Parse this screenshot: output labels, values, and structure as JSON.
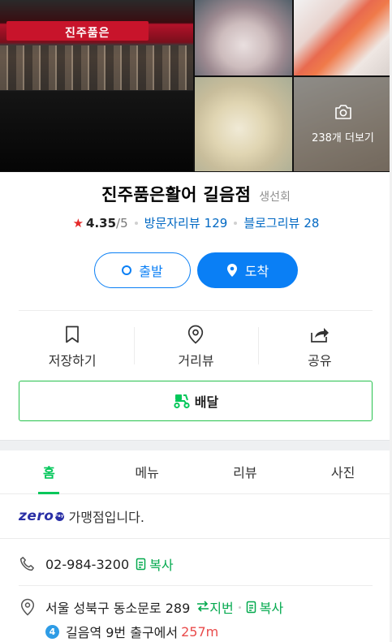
{
  "gallery": {
    "main_sign_text": "진주품은",
    "photo_count_label": "238개 더보기"
  },
  "place": {
    "name": "진주품은활어 길음점",
    "category": "생선회",
    "rating": "4.35",
    "rating_max": "/5",
    "visitor_reviews_label": "방문자리뷰",
    "visitor_reviews_count": "129",
    "blog_reviews_label": "블로그리뷰",
    "blog_reviews_count": "28"
  },
  "route": {
    "start_label": "출발",
    "arrive_label": "도착"
  },
  "actions": {
    "save_label": "저장하기",
    "streetview_label": "거리뷰",
    "share_label": "공유"
  },
  "delivery": {
    "label": "배달"
  },
  "tabs": [
    {
      "label": "홈"
    },
    {
      "label": "메뉴"
    },
    {
      "label": "리뷰"
    },
    {
      "label": "사진"
    }
  ],
  "info": {
    "zero_logo": "zero",
    "zero_pay_mark": "Pay",
    "zero_text": "가맹점입니다.",
    "phone": "02-984-3200",
    "copy_label": "복사",
    "address": "서울 성북구 동소문로 289",
    "jibun_label": "지번",
    "address_copy_label": "복사",
    "station_line": "4",
    "station_text": "길음역 9번 출구에서",
    "station_distance": "257m"
  },
  "colors": {
    "accent_blue": "#0a7ff5",
    "accent_green": "#03c75a",
    "star_red": "#e52929",
    "distance_red": "#e94b4b",
    "line4_blue": "#2e9ce6"
  }
}
